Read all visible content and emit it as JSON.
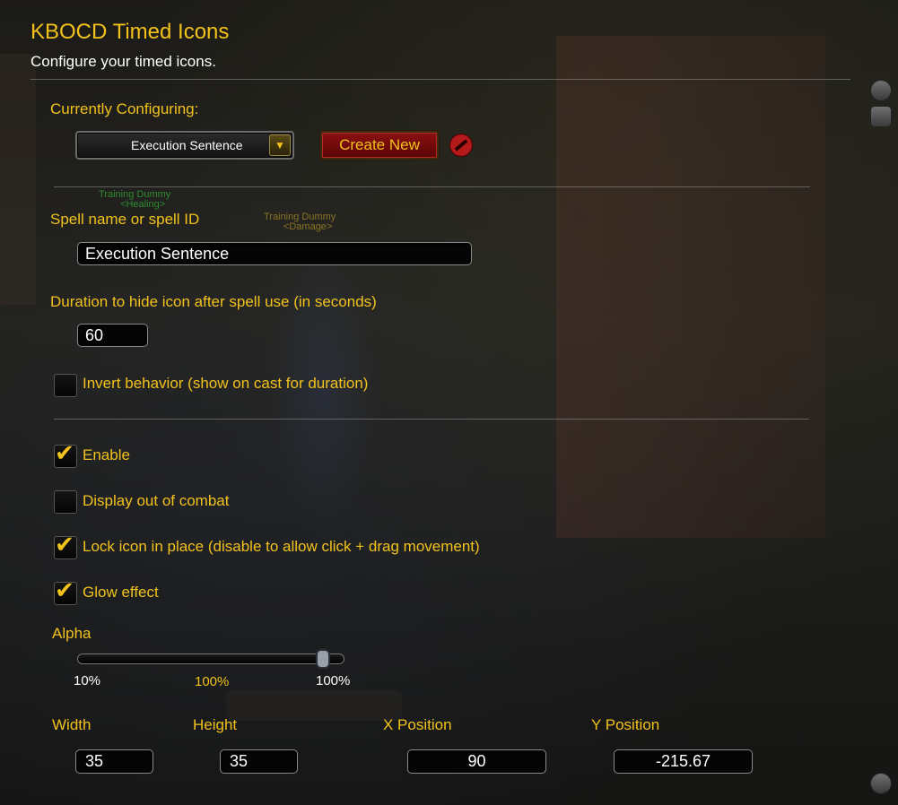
{
  "header": {
    "title": "KBOCD Timed Icons",
    "subtitle": "Configure your timed icons."
  },
  "config": {
    "currently_label": "Currently Configuring:",
    "selected_option": "Execution Sentence",
    "create_button": "Create New"
  },
  "background_text": {
    "dummy_heal_name": "Training Dummy",
    "dummy_heal_tag": "<Healing>",
    "dummy_dmg_name": "Training Dummy",
    "dummy_dmg_tag": "<Damage>"
  },
  "spell": {
    "label": "Spell name or spell ID",
    "value": "Execution Sentence"
  },
  "duration": {
    "label": "Duration to hide icon after spell use (in seconds)",
    "value": "60"
  },
  "checkboxes": {
    "invert": {
      "label": "Invert behavior (show on cast for duration)",
      "checked": false
    },
    "enable": {
      "label": "Enable",
      "checked": true
    },
    "display_ooc": {
      "label": "Display out of combat",
      "checked": false
    },
    "lock": {
      "label": "Lock icon in place (disable to allow click + drag movement)",
      "checked": true
    },
    "glow": {
      "label": "Glow effect",
      "checked": true
    }
  },
  "alpha": {
    "label": "Alpha",
    "min_label": "10%",
    "current_label": "100%",
    "max_label": "100%",
    "value_fraction": 1.0
  },
  "position": {
    "width_label": "Width",
    "width_value": "35",
    "height_label": "Height",
    "height_value": "35",
    "x_label": "X Position",
    "x_value": "90",
    "y_label": "Y Position",
    "y_value": "-215.67"
  },
  "colors": {
    "gold": "#f2c21c",
    "button_red": "#8a1010",
    "white": "#ffffff"
  }
}
